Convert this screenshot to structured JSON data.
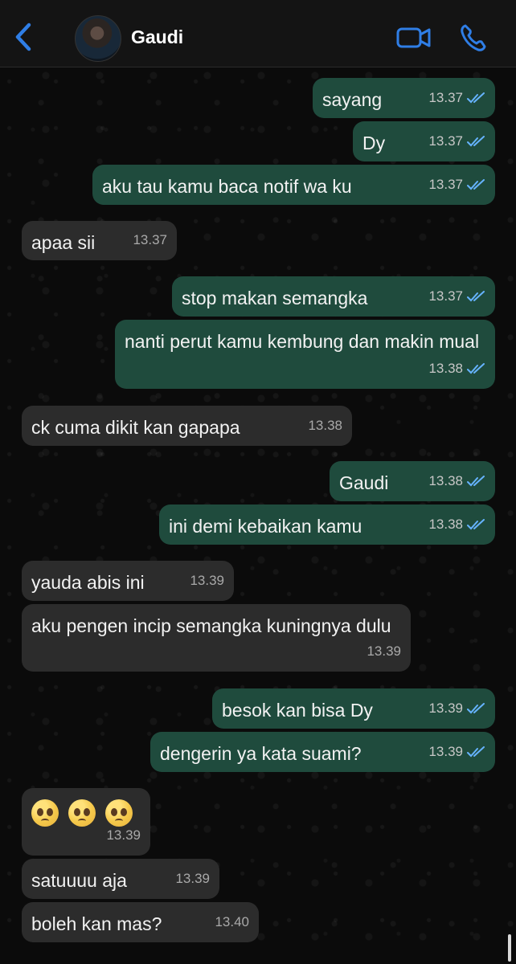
{
  "contact": {
    "name": "Gaudi"
  },
  "icons": {
    "back": "chevron-left-icon",
    "video": "video-camera-icon",
    "phone": "phone-icon",
    "read_receipt": "double-check-icon"
  },
  "colors": {
    "accent": "#2f7ee6",
    "outgoing_bubble": "#1f4b3d",
    "incoming_bubble": "#2c2c2c",
    "tick": "#66b3ff"
  },
  "messages": [
    {
      "dir": "out",
      "text": "sayang",
      "time": "13.37"
    },
    {
      "dir": "out",
      "text": "Dy",
      "time": "13.37"
    },
    {
      "dir": "out",
      "text": "aku tau kamu baca notif wa ku",
      "time": "13.37"
    },
    {
      "dir": "in",
      "text": "apaa sii",
      "time": "13.37"
    },
    {
      "dir": "out",
      "text": "stop makan semangka",
      "time": "13.37"
    },
    {
      "dir": "out",
      "text": "nanti perut kamu kembung dan makin mual",
      "time": "13.38"
    },
    {
      "dir": "in",
      "text": "ck cuma dikit kan gapapa",
      "time": "13.38"
    },
    {
      "dir": "out",
      "text": "Gaudi",
      "time": "13.38"
    },
    {
      "dir": "out",
      "text": "ini demi kebaikan kamu",
      "time": "13.38"
    },
    {
      "dir": "in",
      "text": "yauda abis ini",
      "time": "13.39"
    },
    {
      "dir": "in",
      "text": "aku pengen incip semangka kuningnya dulu",
      "time": "13.39"
    },
    {
      "dir": "out",
      "text": "besok kan bisa Dy",
      "time": "13.39"
    },
    {
      "dir": "out",
      "text": "dengerin ya kata suami?",
      "time": "13.39"
    },
    {
      "dir": "in",
      "text": "",
      "time": "13.39"
    },
    {
      "dir": "in",
      "text": "satuuuu aja",
      "time": "13.39"
    },
    {
      "dir": "in",
      "text": "boleh kan mas?",
      "time": "13.40"
    }
  ]
}
